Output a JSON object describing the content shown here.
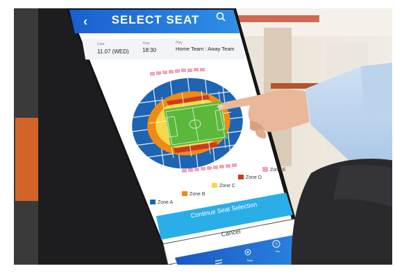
{
  "header": {
    "title": "SELECT SEAT"
  },
  "event": {
    "date_label": "Date",
    "date_value": "11.07 (WED)",
    "time_label": "Time",
    "time_value": "18:30",
    "play_label": "Play",
    "play_value": "Home Team : Away Team"
  },
  "zones": [
    {
      "label": "Zone A",
      "color": "#1d64b3"
    },
    {
      "label": "Zone B",
      "color": "#f08a14"
    },
    {
      "label": "Zone C",
      "color": "#f7d84a"
    },
    {
      "label": "Zone D",
      "color": "#cc3a22"
    },
    {
      "label": "Zone E",
      "color": "#f2a3b5"
    }
  ],
  "buttons": {
    "continue_label": "Continue Seat Selection",
    "cancel_label": "Cancel"
  },
  "bottom_nav": {
    "items": [
      {
        "label": "Menu",
        "icon": "menu-icon"
      },
      {
        "label": "Maps",
        "icon": "map-pin-icon"
      },
      {
        "label": "Info",
        "icon": "info-icon"
      }
    ]
  },
  "colors": {
    "brand_blue": "#1a5fd0",
    "button_cyan": "#2aaee8",
    "pitch_green": "#5cb83a"
  }
}
